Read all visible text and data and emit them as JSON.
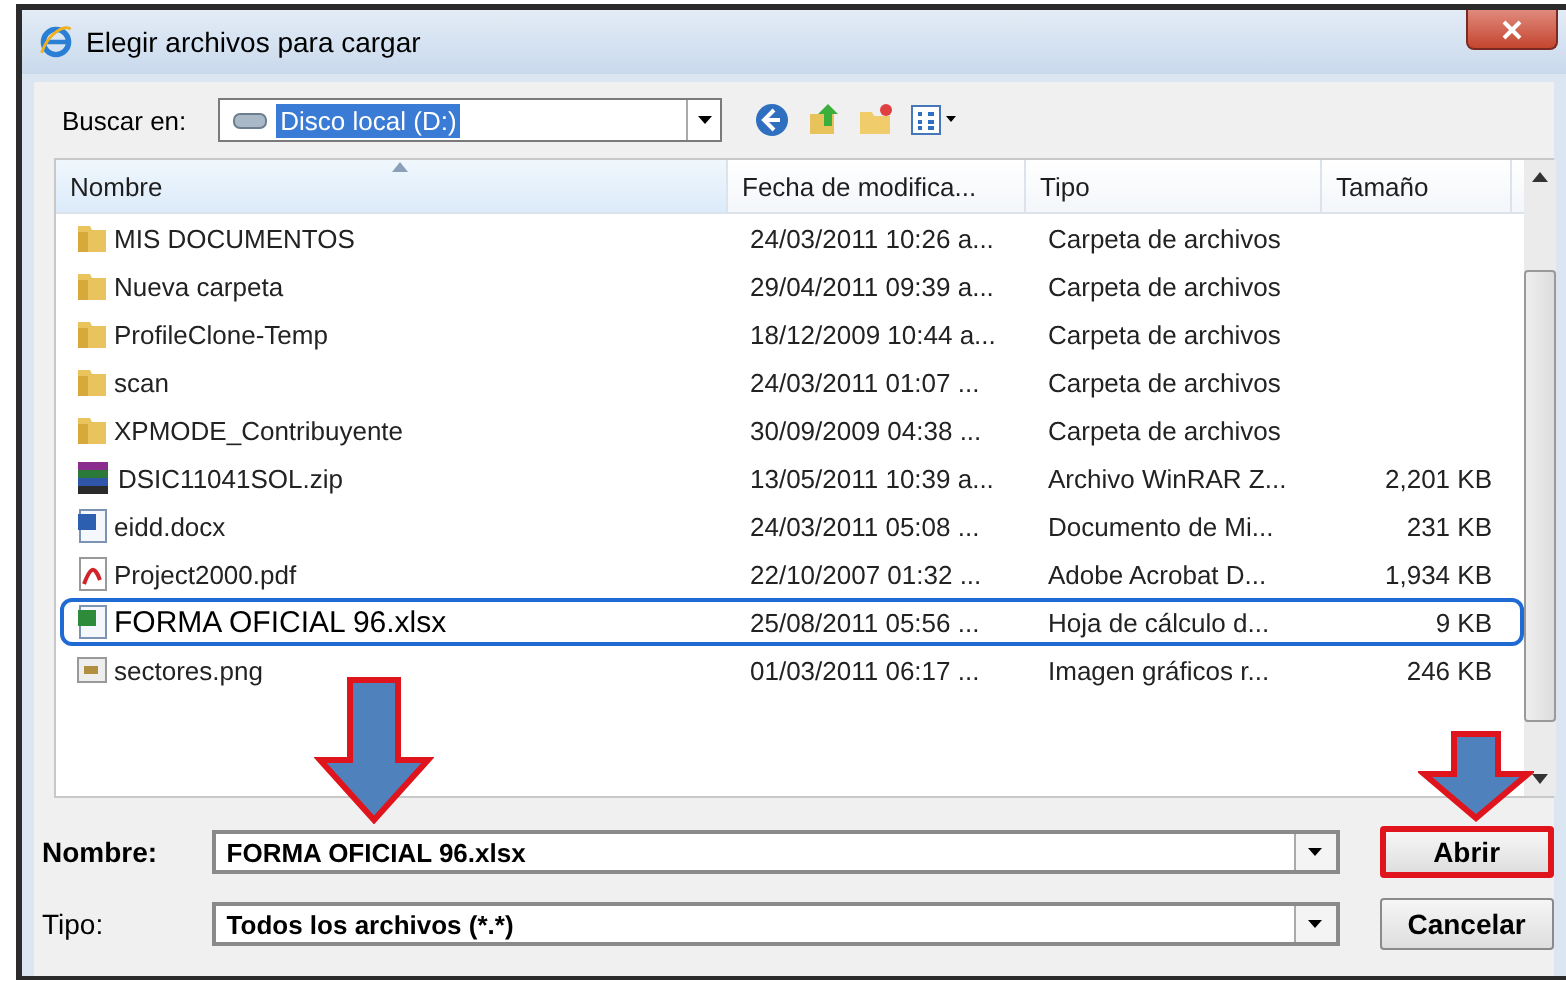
{
  "window": {
    "title": "Elegir archivos para cargar"
  },
  "toolbar": {
    "label": "Buscar en:",
    "location": "Disco local (D:)"
  },
  "table": {
    "columns": [
      {
        "label": "Nombre",
        "sorted": true
      },
      {
        "label": "Fecha de modifica..."
      },
      {
        "label": "Tipo"
      },
      {
        "label": "Tamaño"
      }
    ],
    "rows": [
      {
        "kind": "folder",
        "name": "MIS DOCUMENTOS",
        "date": "24/03/2011 10:26 a...",
        "type": "Carpeta de archivos",
        "selected": false
      },
      {
        "kind": "folder",
        "name": "Nueva carpeta",
        "date": "29/04/2011 09:39 a...",
        "type": "Carpeta de archivos",
        "selected": false
      },
      {
        "kind": "folder",
        "name": "ProfileClone-Temp",
        "date": "18/12/2009 10:44 a...",
        "type": "Carpeta de archivos",
        "selected": false
      },
      {
        "kind": "folder",
        "name": "scan",
        "date": "24/03/2011 01:07 ...",
        "type": "Carpeta de archivos",
        "selected": false
      },
      {
        "kind": "folder",
        "name": "XPMODE_Contribuyente",
        "date": "30/09/2009 04:38 ...",
        "type": "Carpeta de archivos",
        "selected": false
      },
      {
        "kind": "zip",
        "name": "DSIC11041SOL.zip",
        "date": "13/05/2011 10:39 a...",
        "type": "Archivo WinRAR Z...",
        "size": "2,201 KB",
        "selected": false
      },
      {
        "kind": "docx",
        "name": "eidd.docx",
        "date": "24/03/2011 05:08 ...",
        "type": "Documento de Mi...",
        "size": "231 KB",
        "selected": false
      },
      {
        "kind": "pdf",
        "name": "Project2000.pdf",
        "date": "22/10/2007 01:32 ...",
        "type": "Adobe Acrobat D...",
        "size": "1,934 KB",
        "selected": false
      },
      {
        "kind": "xlsx",
        "name": "FORMA OFICIAL 96.xlsx",
        "date": "25/08/2011 05:56 ...",
        "type": "Hoja de cálculo d...",
        "size": "9 KB",
        "selected": true
      },
      {
        "kind": "png",
        "name": "sectores.png",
        "date": "01/03/2011 06:17 ...",
        "type": "Imagen gráficos r...",
        "size": "246 KB",
        "selected": false
      }
    ]
  },
  "fields": [
    {
      "label": "Nombre:",
      "value": "FORMA OFICIAL 96.xlsx"
    },
    {
      "label": "Tipo:",
      "value": "Todos los archivos (*.*)"
    }
  ],
  "buttons": [
    {
      "label": "Abrir",
      "highlighted": true
    },
    {
      "label": "Cancelar",
      "highlighted": false
    }
  ]
}
